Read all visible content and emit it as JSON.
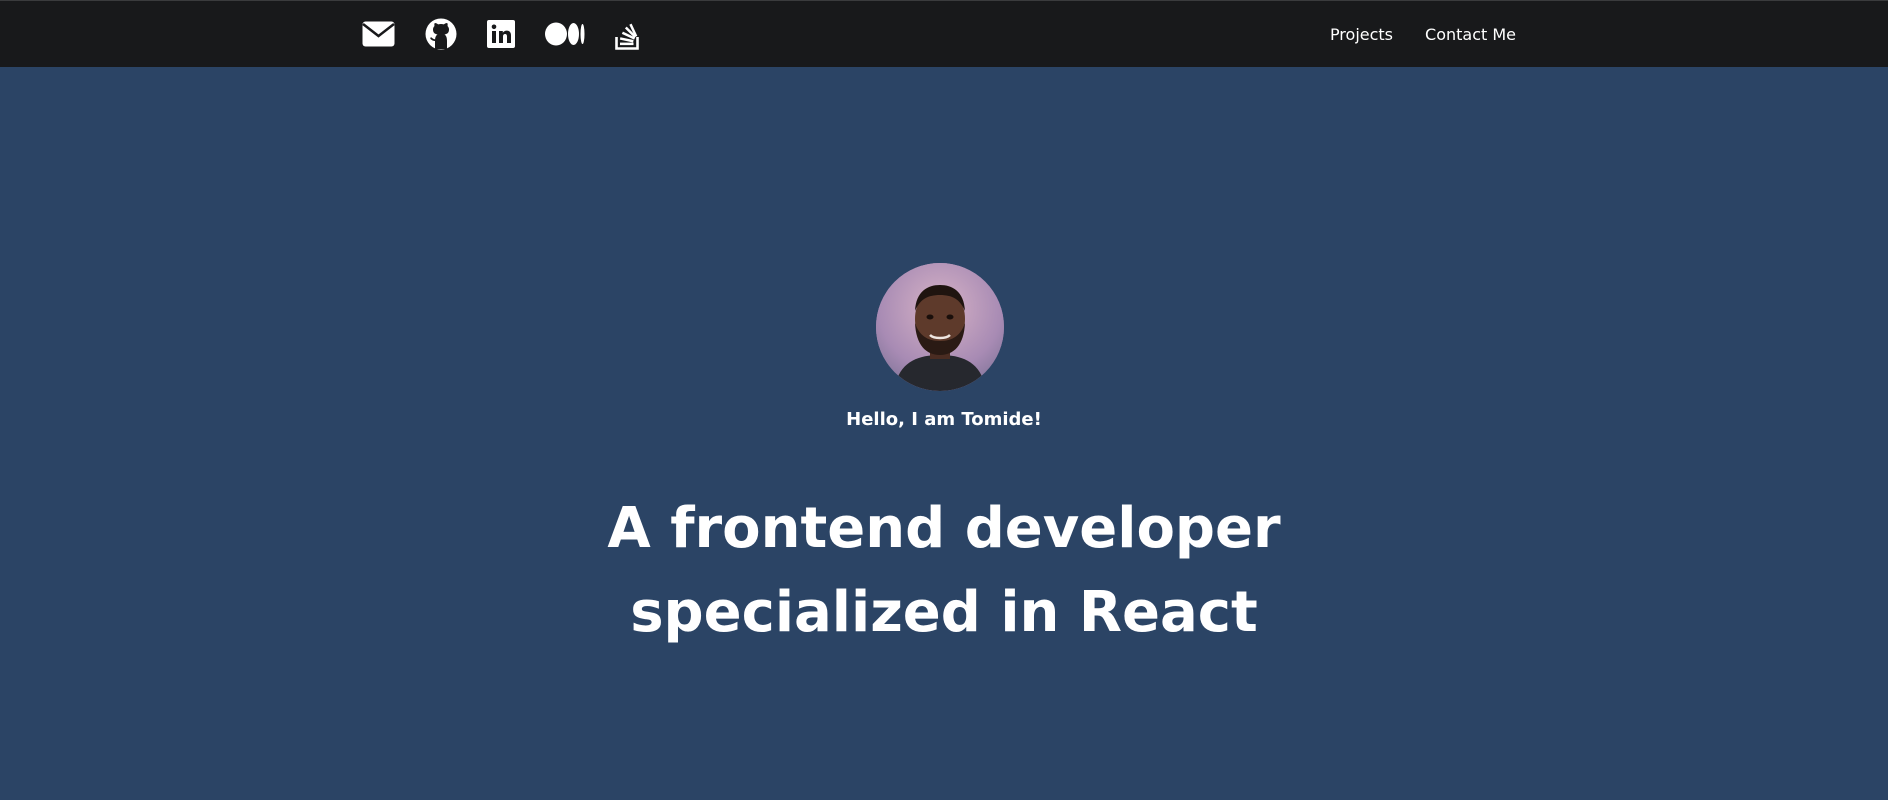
{
  "social_links": [
    {
      "name": "email",
      "icon": "envelope-icon"
    },
    {
      "name": "github",
      "icon": "github-icon"
    },
    {
      "name": "linkedin",
      "icon": "linkedin-icon"
    },
    {
      "name": "medium",
      "icon": "medium-icon"
    },
    {
      "name": "stackoverflow",
      "icon": "stackoverflow-icon"
    }
  ],
  "nav": {
    "projects": "Projects",
    "contact": "Contact Me"
  },
  "hero": {
    "avatar_icon": "profile-photo",
    "greeting": "Hello, I am Tomide!",
    "headline_line1": "A frontend developer",
    "headline_line2": "specialized in React"
  },
  "colors": {
    "topbar": "#18191b",
    "background": "#2b4465",
    "text": "#ffffff"
  }
}
